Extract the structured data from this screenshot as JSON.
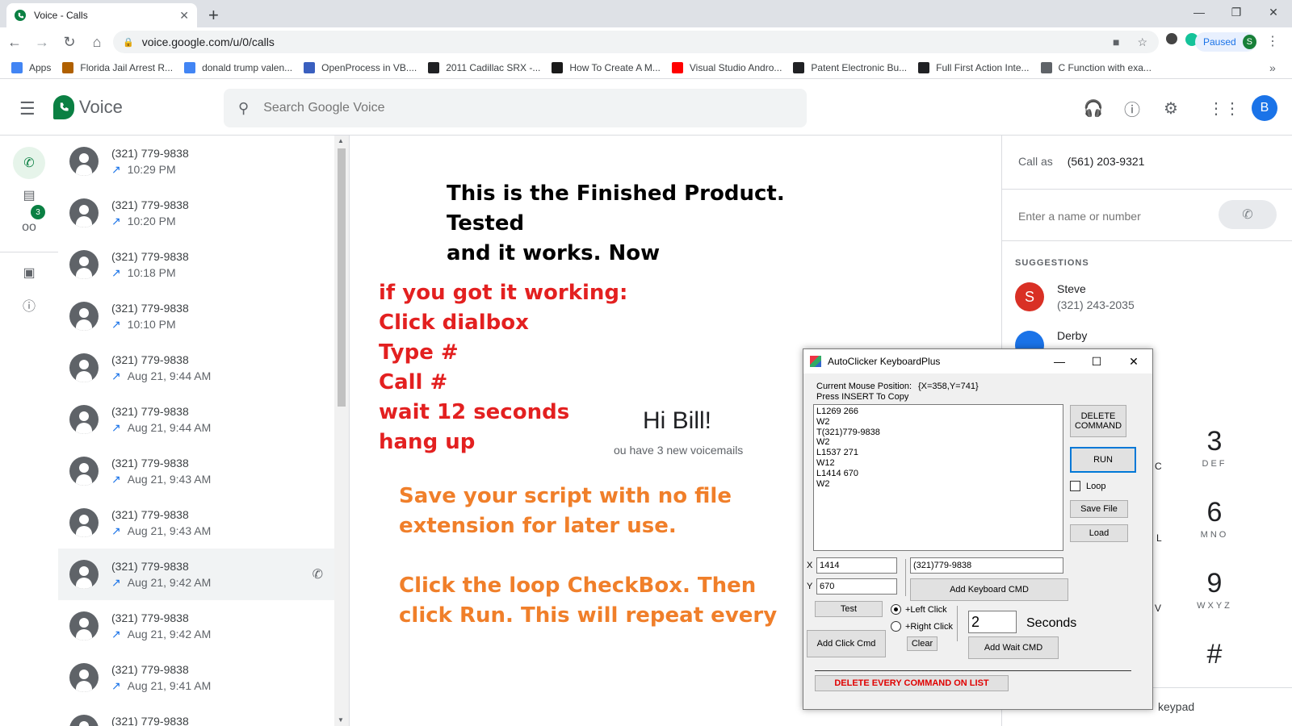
{
  "browser": {
    "tab_title": "Voice - Calls",
    "url": "voice.google.com/u/0/calls",
    "paused_label": "Paused",
    "profile_initial": "S",
    "bookmarks": [
      {
        "label": "Apps",
        "color": "#4285f4"
      },
      {
        "label": "Florida Jail Arrest R...",
        "color": "#b06000"
      },
      {
        "label": "donald trump valen...",
        "color": "#4285f4"
      },
      {
        "label": "OpenProcess in VB....",
        "color": "#3a5fbf"
      },
      {
        "label": "2011 Cadillac SRX -...",
        "color": "#202124"
      },
      {
        "label": "How To Create A M...",
        "color": "#1a1a1a"
      },
      {
        "label": "Visual Studio Andro...",
        "color": "#ff0000"
      },
      {
        "label": "Patent Electronic Bu...",
        "color": "#202124"
      },
      {
        "label": "Full First Action Inte...",
        "color": "#202124"
      },
      {
        "label": "C Function with exa...",
        "color": "#5f6368"
      }
    ]
  },
  "app": {
    "name": "Voice",
    "search_placeholder": "Search Google Voice",
    "avatar_initial": "B",
    "voicemail_badge": "3"
  },
  "calls": [
    {
      "number": "(321) 779-9838",
      "time": "10:29 PM"
    },
    {
      "number": "(321) 779-9838",
      "time": "10:20 PM"
    },
    {
      "number": "(321) 779-9838",
      "time": "10:18 PM"
    },
    {
      "number": "(321) 779-9838",
      "time": "10:10 PM"
    },
    {
      "number": "(321) 779-9838",
      "time": "Aug 21, 9:44 AM"
    },
    {
      "number": "(321) 779-9838",
      "time": "Aug 21, 9:44 AM"
    },
    {
      "number": "(321) 779-9838",
      "time": "Aug 21, 9:43 AM"
    },
    {
      "number": "(321) 779-9838",
      "time": "Aug 21, 9:43 AM"
    },
    {
      "number": "(321) 779-9838",
      "time": "Aug 21, 9:42 AM"
    },
    {
      "number": "(321) 779-9838",
      "time": "Aug 21, 9:42 AM"
    },
    {
      "number": "(321) 779-9838",
      "time": "Aug 21, 9:41 AM"
    },
    {
      "number": "(321) 779-9838",
      "time": ""
    }
  ],
  "main": {
    "greeting": "Hi Bill!",
    "voicemail_msg": "ou have 3 new voicemails"
  },
  "overlay": {
    "black": [
      "This is the Finished Product. Tested",
      "and it works. Now"
    ],
    "red": [
      "if you got it working:",
      "Click dialbox",
      "Type #",
      "Call #",
      "wait 12 seconds",
      "hang up"
    ],
    "orange_1": "Save your script with no file extension for later use.",
    "orange_2": "Click the loop CheckBox. Then click Run. This will repeat every command in order."
  },
  "right_panel": {
    "call_as_label": "Call as",
    "call_as_number": "(561) 203-9321",
    "input_placeholder": "Enter a name or number",
    "suggestions_label": "SUGGESTIONS",
    "contact_name": "Steve",
    "contact_initial": "S",
    "contact_phone": "(321) 243-2035",
    "contact2_name": "Derby",
    "keypad": [
      {
        "digit": "3",
        "letters": "DEF"
      },
      {
        "digit": "6",
        "letters": "MNO"
      },
      {
        "digit": "9",
        "letters": "WXYZ"
      },
      {
        "digit": "#",
        "letters": ""
      }
    ],
    "partial_letters": [
      "C",
      "L",
      "V"
    ],
    "keypad_label": "keypad"
  },
  "autoclicker": {
    "title": "AutoClicker KeyboardPlus",
    "mouse_pos_label": "Current Mouse Position:",
    "mouse_pos_value": "{X=358,Y=741}",
    "insert_hint": "Press INSERT To Copy",
    "script": "L1269 266\nW2\nT(321)779-9838\nW2\nL1537 271\nW12\nL1414 670\nW2",
    "delete_command": "DELETE COMMAND",
    "run": "RUN",
    "loop": "Loop",
    "save_file": "Save File",
    "load": "Load",
    "x_label": "X",
    "x_value": "1414",
    "y_label": "Y",
    "y_value": "670",
    "keyboard_text": "(321)779-9838",
    "add_keyboard_cmd": "Add Keyboard CMD",
    "test": "Test",
    "left_click": "+Left Click",
    "right_click": "+Right Click",
    "wait_value": "2",
    "seconds_label": "Seconds",
    "add_click_cmd": "Add Click Cmd",
    "clear": "Clear",
    "add_wait_cmd": "Add Wait CMD",
    "delete_all": "DELETE EVERY COMMAND ON LIST"
  }
}
